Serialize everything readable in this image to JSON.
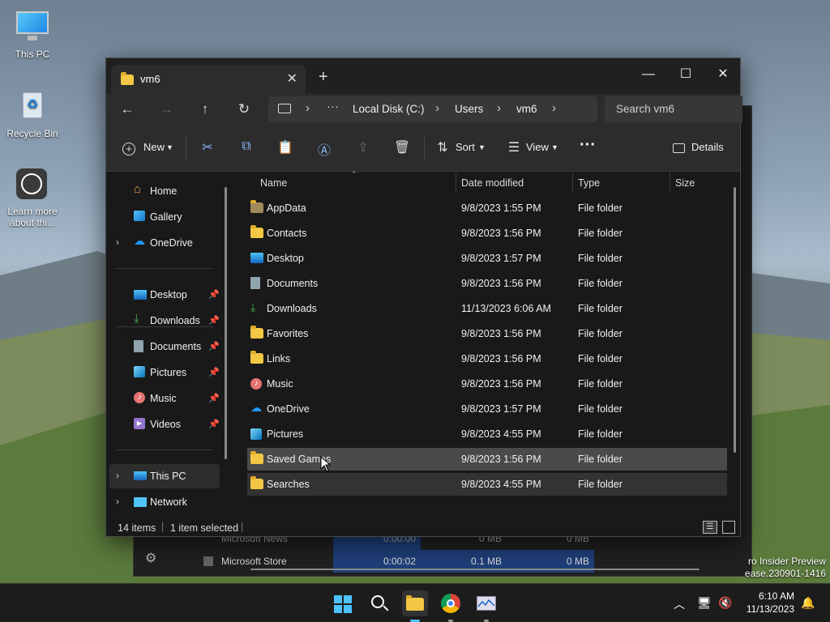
{
  "desktop": {
    "icons": [
      {
        "label": "This PC"
      },
      {
        "label": "Recycle Bin"
      },
      {
        "label": "Learn more about thi..."
      }
    ],
    "watermark": [
      "ro Insider Preview",
      "ease.230901-1416"
    ]
  },
  "task_manager": {
    "rows": [
      {
        "name": "Microsoft News",
        "time": "0:00:00",
        "c1": "0 MB",
        "c2": "0 MB"
      },
      {
        "name": "Microsoft Store",
        "time": "0:00:02",
        "c1": "0.1 MB",
        "c2": "0 MB"
      }
    ]
  },
  "explorer": {
    "tab_title": "vm6",
    "window_controls": {
      "minimize": "—",
      "maximize": "☐",
      "close": "✕"
    },
    "breadcrumb": [
      "Local Disk (C:)",
      "Users",
      "vm6"
    ],
    "search_placeholder": "Search vm6",
    "commands": {
      "new": "New",
      "sort": "Sort",
      "view": "View",
      "details": "Details"
    },
    "nav": {
      "top": [
        {
          "label": "Home",
          "icon": "home-icon"
        },
        {
          "label": "Gallery",
          "icon": "gallery-icon"
        },
        {
          "label": "OneDrive",
          "icon": "cloud-icon"
        }
      ],
      "pinned": [
        {
          "label": "Desktop",
          "icon": "desktop-icon"
        },
        {
          "label": "Downloads",
          "icon": "download-icon"
        },
        {
          "label": "Documents",
          "icon": "document-icon"
        },
        {
          "label": "Pictures",
          "icon": "pictures-icon"
        },
        {
          "label": "Music",
          "icon": "music-icon"
        },
        {
          "label": "Videos",
          "icon": "videos-icon"
        }
      ],
      "bottom": [
        {
          "label": "This PC",
          "icon": "pc-icon"
        },
        {
          "label": "Network",
          "icon": "network-icon"
        }
      ]
    },
    "columns": [
      "Name",
      "Date modified",
      "Type",
      "Size"
    ],
    "files": [
      {
        "name": "AppData",
        "date": "9/8/2023 1:55 PM",
        "type": "File folder",
        "icon": "folder"
      },
      {
        "name": "Contacts",
        "date": "9/8/2023 1:56 PM",
        "type": "File folder",
        "icon": "folder"
      },
      {
        "name": "Desktop",
        "date": "9/8/2023 1:57 PM",
        "type": "File folder",
        "icon": "desktop"
      },
      {
        "name": "Documents",
        "date": "9/8/2023 1:56 PM",
        "type": "File folder",
        "icon": "document"
      },
      {
        "name": "Downloads",
        "date": "11/13/2023 6:06 AM",
        "type": "File folder",
        "icon": "download"
      },
      {
        "name": "Favorites",
        "date": "9/8/2023 1:56 PM",
        "type": "File folder",
        "icon": "folder"
      },
      {
        "name": "Links",
        "date": "9/8/2023 1:56 PM",
        "type": "File folder",
        "icon": "folder"
      },
      {
        "name": "Music",
        "date": "9/8/2023 1:56 PM",
        "type": "File folder",
        "icon": "music"
      },
      {
        "name": "OneDrive",
        "date": "9/8/2023 1:57 PM",
        "type": "File folder",
        "icon": "cloud"
      },
      {
        "name": "Pictures",
        "date": "9/8/2023 4:55 PM",
        "type": "File folder",
        "icon": "pictures"
      },
      {
        "name": "Saved Games",
        "date": "9/8/2023 1:56 PM",
        "type": "File folder",
        "icon": "folder"
      },
      {
        "name": "Searches",
        "date": "9/8/2023 4:55 PM",
        "type": "File folder",
        "icon": "folder"
      }
    ],
    "status": {
      "count": "14 items",
      "selected": "1 item selected"
    }
  },
  "taskbar": {
    "time": "6:10 AM",
    "date": "11/13/2023"
  }
}
